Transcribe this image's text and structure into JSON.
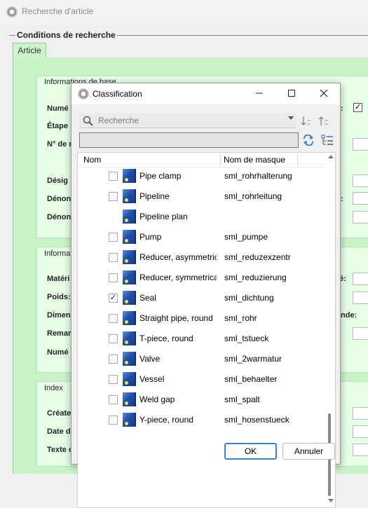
{
  "window": {
    "title": "Recherche d'article"
  },
  "search_conditions": {
    "title": "Conditions de recherche",
    "tab": "Article"
  },
  "background": {
    "section1_title": "Informations de base",
    "section2_title": "Informat",
    "section3_title": "Index",
    "labels1": [
      "Numé",
      "Étape",
      "N° de n",
      "Désig",
      "Dénon",
      "Dénon"
    ],
    "labels2": [
      "Matéri",
      "Poids:",
      "Dimen",
      "Remar",
      "Numé"
    ],
    "labels3": [
      "Créate",
      "Date d",
      "Texte c"
    ],
    "right_labels": [
      ":",
      ":",
      "é:",
      "nde:"
    ]
  },
  "dialog": {
    "title": "Classification",
    "search_placeholder": "Recherche",
    "filter_value": "",
    "columns": {
      "name": "Nom",
      "mask": "Nom de masque"
    },
    "rows": [
      {
        "name": "Pipe clamp",
        "mask": "sml_rohrhalterung",
        "checked": false,
        "has_checkbox": true
      },
      {
        "name": "Pipeline",
        "mask": "sml_rohrleitung",
        "checked": false,
        "has_checkbox": true
      },
      {
        "name": "Pipeline plan",
        "mask": "",
        "checked": false,
        "has_checkbox": false
      },
      {
        "name": "Pump",
        "mask": "sml_pumpe",
        "checked": false,
        "has_checkbox": true
      },
      {
        "name": "Reducer, asymmetric",
        "mask": "sml_reduzexzentr",
        "checked": false,
        "has_checkbox": true
      },
      {
        "name": "Reducer, symmetrical",
        "mask": "sml_reduzierung",
        "checked": false,
        "has_checkbox": true
      },
      {
        "name": "Seal",
        "mask": "sml_dichtung",
        "checked": true,
        "has_checkbox": true
      },
      {
        "name": "Straight pipe, round",
        "mask": "sml_rohr",
        "checked": false,
        "has_checkbox": true
      },
      {
        "name": "T-piece, round",
        "mask": "sml_tstueck",
        "checked": false,
        "has_checkbox": true
      },
      {
        "name": "Valve",
        "mask": "sml_2warmatur",
        "checked": false,
        "has_checkbox": true
      },
      {
        "name": "Vessel",
        "mask": "sml_behaelter",
        "checked": false,
        "has_checkbox": true
      },
      {
        "name": "Weld gap",
        "mask": "sml_spalt",
        "checked": false,
        "has_checkbox": true
      },
      {
        "name": "Y-piece, round",
        "mask": "sml_hosenstueck",
        "checked": false,
        "has_checkbox": true
      }
    ],
    "ok_label": "OK",
    "cancel_label": "Annuler"
  }
}
